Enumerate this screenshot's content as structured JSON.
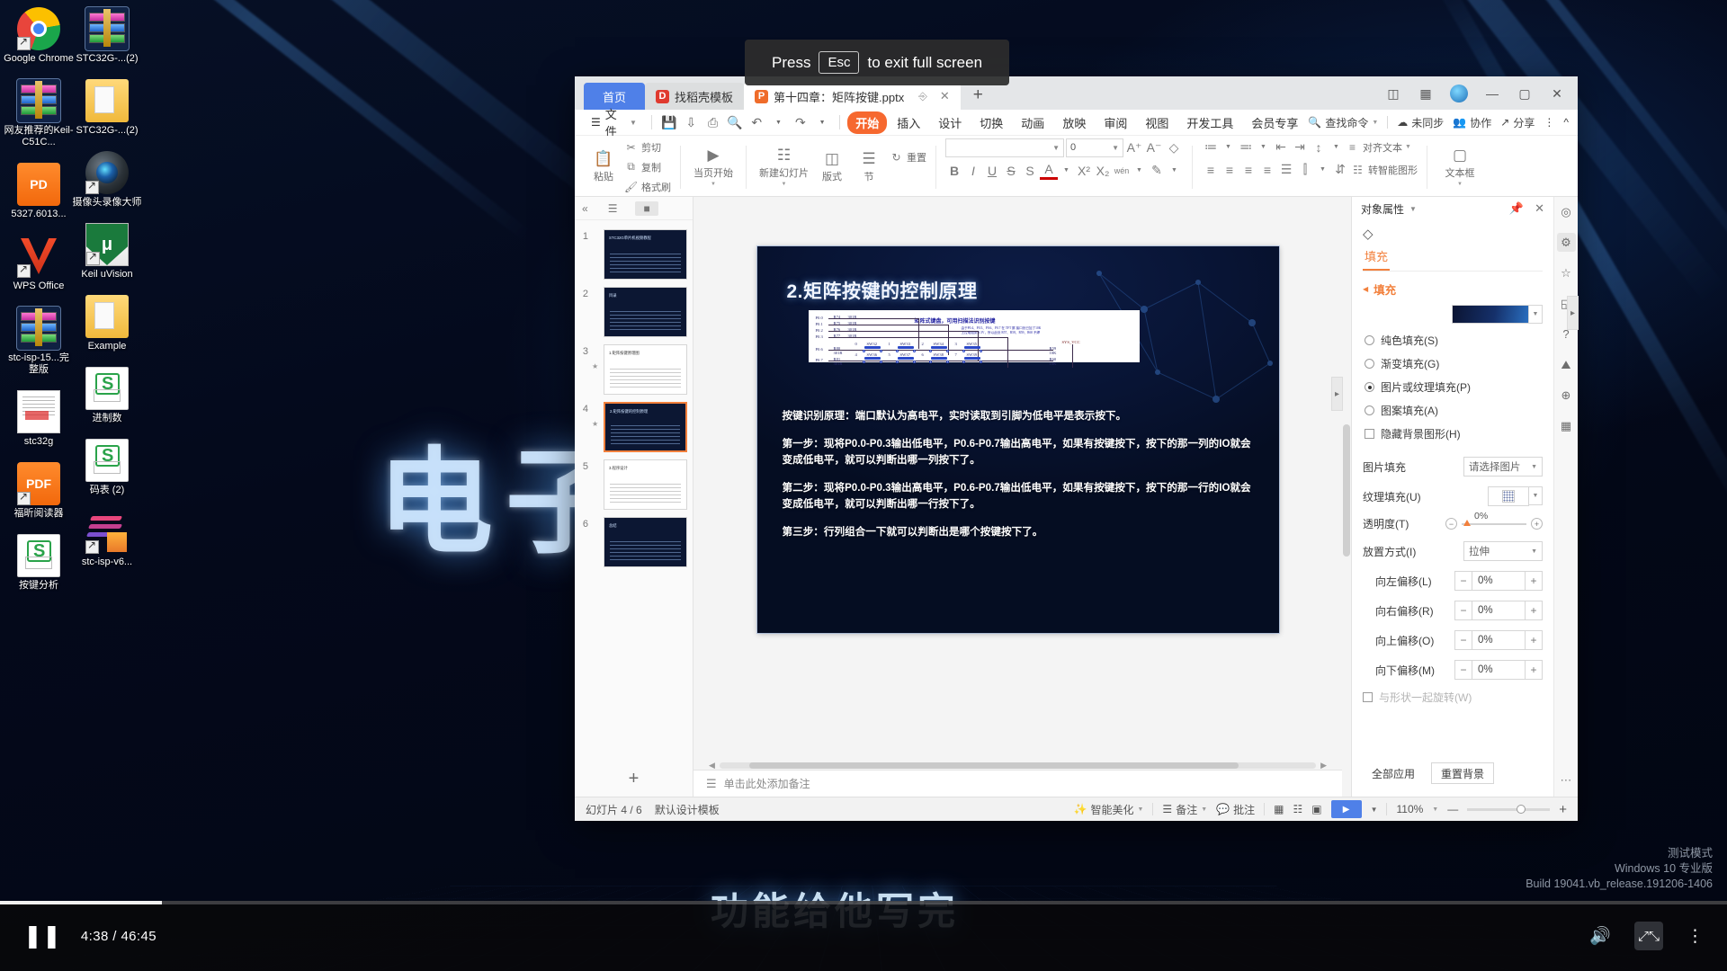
{
  "desktop": {
    "icons_col1": [
      {
        "label": "Google Chrome",
        "icon": "chrome-icon",
        "selected": false
      },
      {
        "label": "网友推荐的Keil-C51C...",
        "icon": "winrar-archive-icon",
        "selected": true
      },
      {
        "label": "5327.6013...",
        "icon": "pdf-package-icon",
        "selected": false
      },
      {
        "label": "WPS Office",
        "icon": "wps-office-icon",
        "selected": false
      },
      {
        "label": "stc-isp-15...完整版",
        "icon": "winrar-archive-icon",
        "selected": true
      },
      {
        "label": "stc32g",
        "icon": "document-preview-icon",
        "selected": false
      },
      {
        "label": "福昕阅读器",
        "icon": "foxit-pdf-icon",
        "selected": false
      },
      {
        "label": "按键分析",
        "icon": "et-spreadsheet-icon",
        "selected": false
      }
    ],
    "icons_col2": [
      {
        "label": "STC32G-...(2)",
        "icon": "winrar-archive-icon",
        "selected": true
      },
      {
        "label": "STC32G-...(2)",
        "icon": "folder-icon",
        "selected": false
      },
      {
        "label": "摄像头录像大师",
        "icon": "camera-recorder-icon",
        "selected": false
      },
      {
        "label": "Keil uVision",
        "icon": "keil-uvision-icon",
        "selected": false
      },
      {
        "label": "Example",
        "icon": "folder-icon",
        "selected": false
      },
      {
        "label": "进制数",
        "icon": "et-spreadsheet-icon",
        "selected": false
      },
      {
        "label": "码表 (2)",
        "icon": "et-spreadsheet-icon",
        "selected": false
      },
      {
        "label": "stc-isp-v6...",
        "icon": "stc-isp-icon",
        "selected": false
      }
    ],
    "wallpaper_text": "电子",
    "wallpaper_subtitle": "功能给他写完"
  },
  "esc_banner": {
    "prefix": "Press",
    "key": "Esc",
    "suffix": "to exit full screen"
  },
  "wps": {
    "tabs": {
      "home_label": "首页",
      "items": [
        {
          "label": "找稻壳模板",
          "icon": "docer-icon",
          "active": false
        },
        {
          "label": "第十四章：矩阵按键.pptx",
          "icon": "pptx-icon",
          "active": true
        }
      ],
      "new_tab": "+"
    },
    "window_controls": {
      "restore_view": "⊞",
      "grid_view": "⊞",
      "minimize": "—",
      "maximize": "▢",
      "close": "✕"
    },
    "menu": {
      "file_label": "文件",
      "quick_icons": [
        "save-icon",
        "save-as-cloud-icon",
        "print-icon",
        "print-preview-icon",
        "undo-icon",
        "redo-icon",
        "customize-icon"
      ],
      "tabs": [
        "开始",
        "插入",
        "设计",
        "切换",
        "动画",
        "放映",
        "审阅",
        "视图",
        "开发工具",
        "会员专享"
      ],
      "selected_tab": "开始",
      "search_placeholder": "查找命令",
      "right_items": [
        {
          "label": "未同步",
          "icon": "cloud-sync-icon"
        },
        {
          "label": "协作",
          "icon": "collaborate-icon"
        },
        {
          "label": "分享",
          "icon": "share-icon"
        }
      ],
      "more": "⋮",
      "collapse": "^"
    },
    "ribbon": {
      "clipboard": {
        "paste": "粘贴",
        "cut": "剪切",
        "copy": "复制",
        "format_painter": "格式刷"
      },
      "slideshow": {
        "from_current": "当页开始"
      },
      "slides": {
        "new_slide": "新建幻灯片",
        "layout": "版式",
        "section": "节",
        "reset": "重置"
      },
      "font": {
        "name": "",
        "size": "0",
        "grow": "A⁺",
        "shrink": "A⁻",
        "clear_format": "◇",
        "bold": "B",
        "italic": "I",
        "underline": "U",
        "strike": "S",
        "shadow": "S",
        "font_color": "A",
        "superscript": "X²",
        "subscript": "X₂",
        "pinyin": "wén",
        "highlight": "highlight-icon"
      },
      "paragraph": {
        "bullets": "≔",
        "numbering": "≕",
        "indent_dec": "⇤",
        "indent_inc": "⇥",
        "align_left": "≡",
        "align_center": "≡",
        "align_right": "≡",
        "justify": "≡",
        "line_spacing": "↕",
        "columns": "⫿",
        "direction": "⇵",
        "text_direction": "对齐文本",
        "align_text": "对齐文本",
        "smart_shape": "转智能图形",
        "text_box": "文本框"
      }
    },
    "slide_panel": {
      "outline_icon": "outline-icon",
      "thumbnail_icon": "thumbnail-icon",
      "collapse_icon": "«",
      "add_slide": "+",
      "slides": [
        {
          "n": "1",
          "title": "STC32G单片机视频教程",
          "style": "dark",
          "anim": false
        },
        {
          "n": "2",
          "title": "目录",
          "style": "dark",
          "anim": false
        },
        {
          "n": "3",
          "title": "1.矩阵按键原理图",
          "style": "white",
          "anim": true
        },
        {
          "n": "4",
          "title": "2.矩阵按键的控制原理",
          "style": "dark",
          "anim": true,
          "active": true
        },
        {
          "n": "5",
          "title": "3.程序设计",
          "style": "white",
          "anim": false
        },
        {
          "n": "6",
          "title": "总结",
          "style": "dark",
          "anim": false
        }
      ]
    },
    "slide": {
      "title": "2.矩阵按键的控制原理",
      "figure": {
        "heading": "矩阵式键盘，可用扫描法识别按键",
        "note_line1": "由于P0.4、P0.5、P0.6、P0.7 在 TFT 屏 接口处已加了10K",
        "note_line2": "上拉电阻到 3.3V，所以此处 R57、R58、R59、R60 不焊",
        "rows": [
          {
            "port": "P0.0",
            "res": "R74",
            "val": "301R"
          },
          {
            "port": "P0.1",
            "res": "R75",
            "val": "301R"
          },
          {
            "port": "P0.2",
            "res": "R76",
            "val": "301R"
          },
          {
            "port": "P0.3",
            "res": "R77",
            "val": "301R"
          }
        ],
        "cols": [
          {
            "port": "P0.6",
            "res": "R80",
            "val": "301R",
            "pull": "R59",
            "pullval": "10K"
          },
          {
            "port": "P0.7",
            "res": "R81",
            "val": "301R",
            "pull": "R60",
            "pullval": "10K"
          }
        ],
        "switches_row1": [
          {
            "num": "0",
            "name": "SW32"
          },
          {
            "num": "1",
            "name": "SW33"
          },
          {
            "num": "2",
            "name": "SW34"
          },
          {
            "num": "3",
            "name": "SW35"
          }
        ],
        "switches_row2": [
          {
            "num": "4",
            "name": "SW36"
          },
          {
            "num": "5",
            "name": "SW37"
          },
          {
            "num": "6",
            "name": "SW38"
          },
          {
            "num": "7",
            "name": "SW39"
          }
        ],
        "vcc": "SYS_VCC"
      },
      "body": [
        "按键识别原理：端口默认为高电平，实时读取到引脚为低电平是表示按下。",
        "第一步：现将P0.0-P0.3输出低电平，P0.6-P0.7输出高电平，如果有按键按下，按下的那一列的IO就会变成低电平，就可以判断出哪一列按下了。",
        "第二步：现将P0.0-P0.3输出高电平，P0.6-P0.7输出低电平，如果有按键按下，按下的那一行的IO就会变成低电平，就可以判断出哪一行按下了。",
        "第三步：行列组合一下就可以判断出是哪个按键按下了。"
      ]
    },
    "notes_placeholder": "单击此处添加备注",
    "notes_icon": "notes-icon",
    "properties": {
      "panel_title": "对象属性",
      "pin_icon": "pin-icon",
      "close_icon": "close-icon",
      "shape_icon": "shape-fill-icon",
      "tab": "填充",
      "section": "填充",
      "fill_swatch_color": "#15306a",
      "options": [
        {
          "label": "纯色填充(S)",
          "type": "radio",
          "checked": false
        },
        {
          "label": "渐变填充(G)",
          "type": "radio",
          "checked": false
        },
        {
          "label": "图片或纹理填充(P)",
          "type": "radio",
          "checked": true
        },
        {
          "label": "图案填充(A)",
          "type": "radio",
          "checked": false
        },
        {
          "label": "隐藏背景图形(H)",
          "type": "checkbox",
          "checked": false
        }
      ],
      "picture_fill": {
        "label": "图片填充",
        "value": "请选择图片"
      },
      "texture_fill": {
        "label": "纹理填充(U)"
      },
      "transparency": {
        "label": "透明度(T)",
        "value": "0%"
      },
      "placement": {
        "label": "放置方式(I)",
        "value": "拉伸"
      },
      "offsets": [
        {
          "label": "向左偏移(L)",
          "value": "0%"
        },
        {
          "label": "向右偏移(R)",
          "value": "0%"
        },
        {
          "label": "向上偏移(O)",
          "value": "0%"
        },
        {
          "label": "向下偏移(M)",
          "value": "0%"
        }
      ],
      "rotate_with_shape": "与形状一起旋转(W)",
      "apply_all": "全部应用",
      "reset_bg": "重置背景"
    },
    "rail_icons": [
      "help-circle-icon",
      "properties-icon",
      "star-icon",
      "shapes-icon",
      "question-icon",
      "picture-icon",
      "globe-icon",
      "grid-icon"
    ],
    "statusbar": {
      "slide_counter": "幻灯片 4 / 6",
      "template": "默认设计模板",
      "beautify": "智能美化",
      "notes": "备注",
      "comments": "批注",
      "views": [
        "normal-view-icon",
        "slide-sorter-icon",
        "reading-view-icon"
      ],
      "play": "▶",
      "zoom": "110%",
      "zoom_out": "—",
      "zoom_in": "+"
    }
  },
  "player": {
    "play_pause": "❚❚",
    "current_time": "4:38",
    "total_time": "46:45",
    "time_separator": "/",
    "progress_percent": 9.4,
    "volume_icon": "volume-icon",
    "fullscreen_icon": "fullscreen-exit-icon",
    "more_icon": "more-vertical-icon"
  },
  "watermark": {
    "line1": "测试模式",
    "line2": "Windows 10 专业版",
    "line3": "Build 19041.vb_release.191206-1406"
  }
}
